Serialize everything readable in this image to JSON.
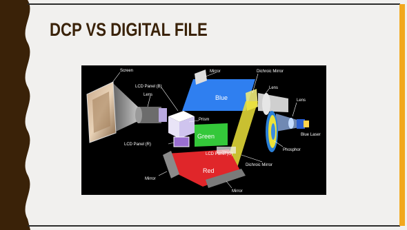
{
  "slide": {
    "title": "DCP VS DIGITAL FILE",
    "colors": {
      "accent_left": "#3a2208",
      "accent_right": "#f2a81d",
      "title": "#3a2208",
      "background": "#f1f0ee"
    }
  },
  "diagram": {
    "labels": {
      "screen": "Screen",
      "lens_left": "Lens",
      "lcd_panel_b": "LCD Panel (B)",
      "mirror_top": "Mirror",
      "dichroic_mirror_top": "Dichroic Mirror",
      "lens_right": "Lens",
      "lens_far": "Lens",
      "blue": "Blue",
      "prism": "Prism",
      "lcd_panel_r": "LCD Panel (R)",
      "green": "Green",
      "lcd_panel_g": "LCD Panel (G)",
      "dichroic_mirror_bottom": "Dichroic Mirror",
      "phosphor": "Phosphor",
      "blue_laser": "Blue Laser",
      "red": "Red",
      "mirror_left": "Mirror",
      "mirror_bottom": "Mirror"
    },
    "colors": {
      "blue": "#2f7ff0",
      "green": "#34c83a",
      "red": "#e0262a",
      "yellow": "#ece23a"
    }
  }
}
